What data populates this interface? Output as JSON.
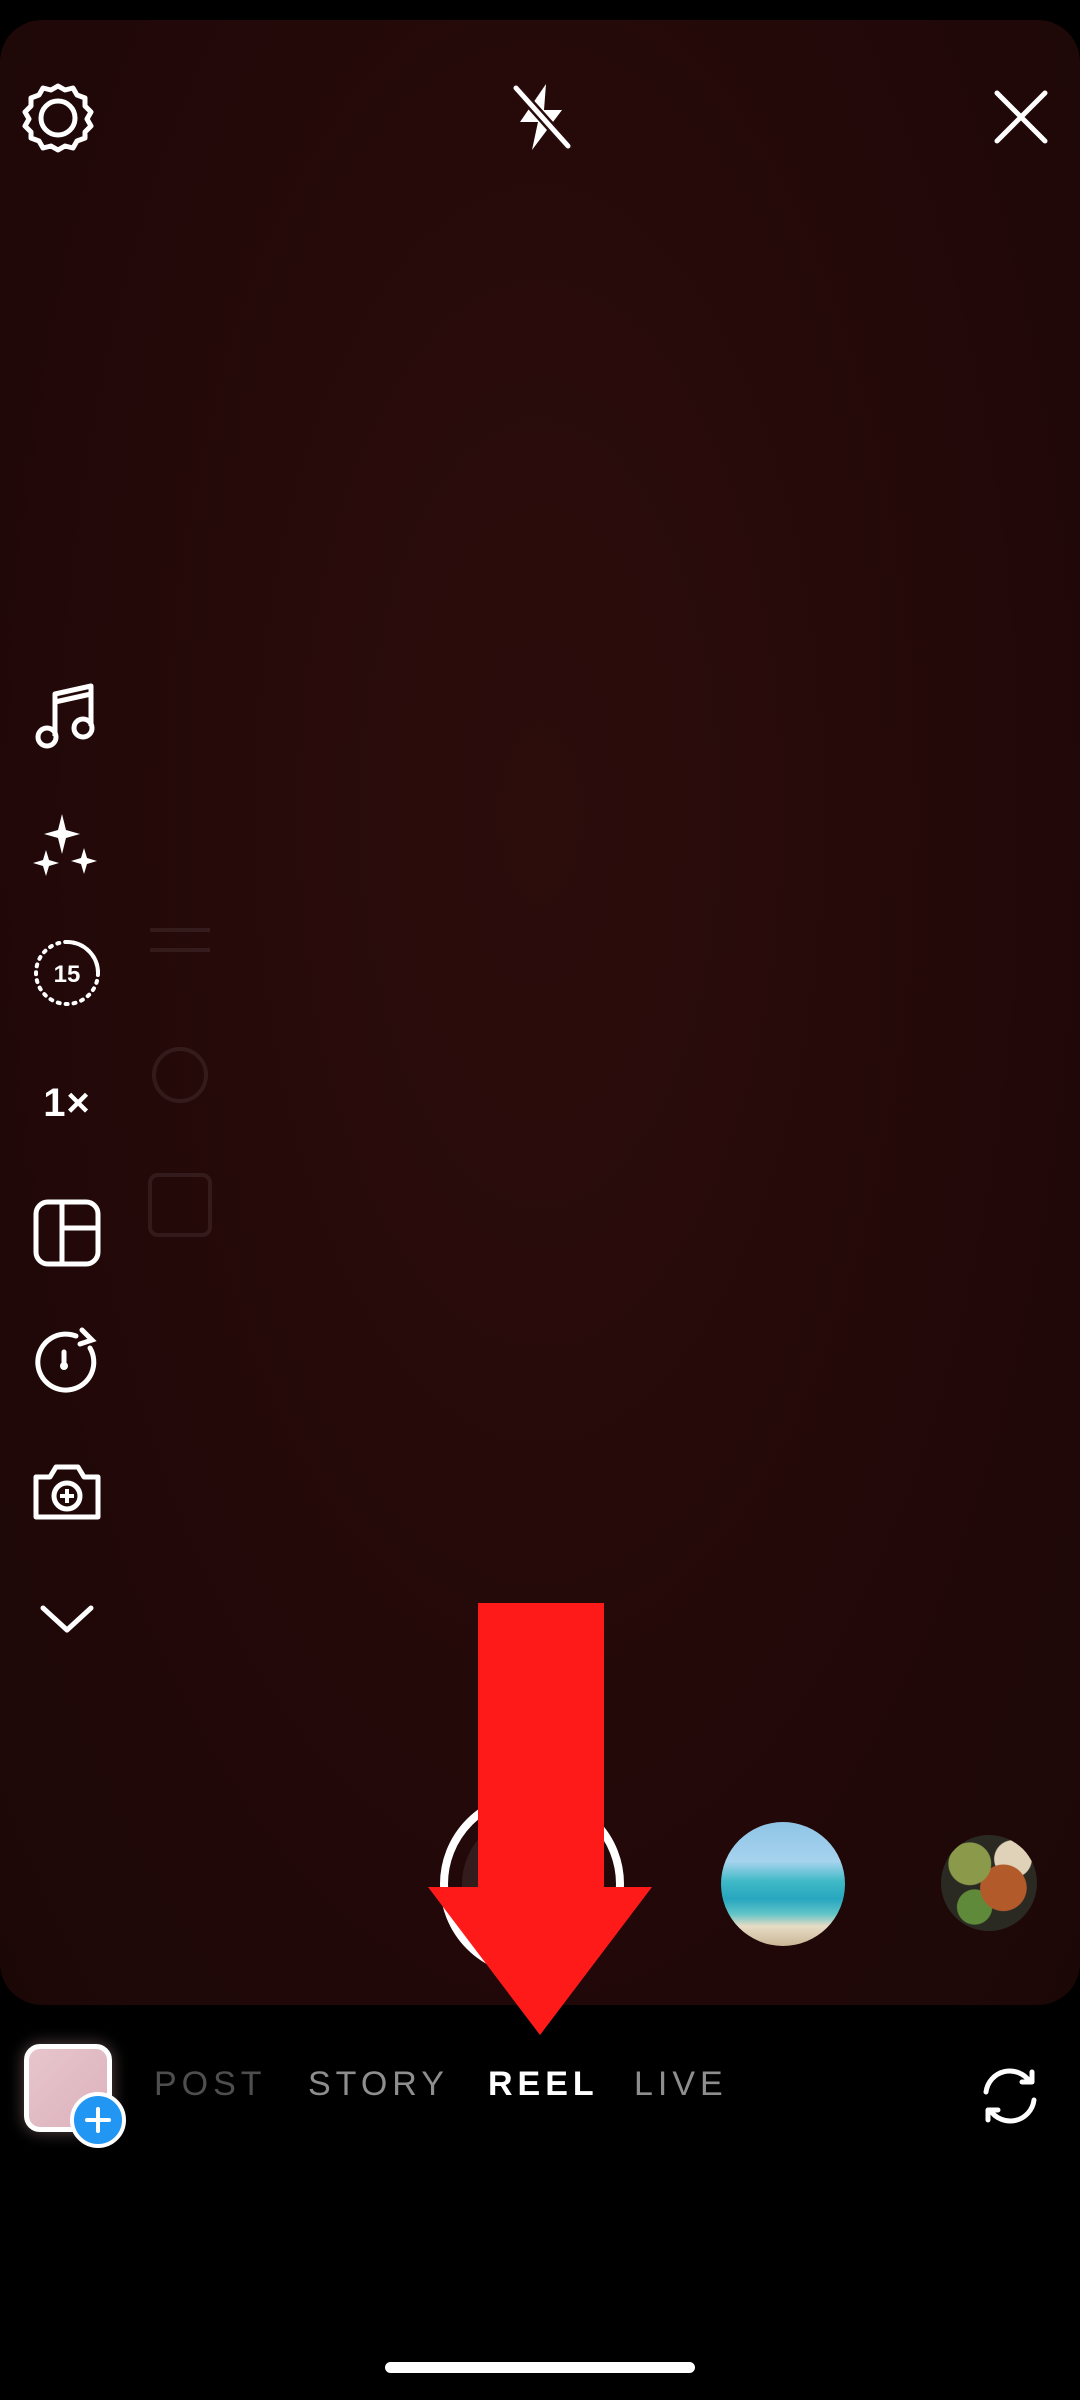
{
  "camera": {
    "top_controls": {
      "settings_icon": "gear-icon",
      "flash_icon": "flash-off-icon",
      "close_icon": "close-icon"
    },
    "side_tools": {
      "audio_icon": "music-note-icon",
      "effects_icon": "sparkles-icon",
      "length_label": "15",
      "speed_label": "1×",
      "layout_icon": "layout-grid-icon",
      "timer_icon": "timer-icon",
      "dual_camera_icon": "camera-plus-icon",
      "more_icon": "chevron-down-icon"
    },
    "effects_tray": [
      "beach-scene",
      "food-plate"
    ]
  },
  "modes": {
    "tabs": [
      "POST",
      "STORY",
      "REEL",
      "LIVE"
    ],
    "selected": "REEL"
  },
  "annotation": {
    "arrow_color": "#ff1a1a",
    "points_to": "REEL"
  },
  "colors": {
    "accent_blue": "#2196f3",
    "background": "#000000",
    "viewfinder": "#240909"
  }
}
